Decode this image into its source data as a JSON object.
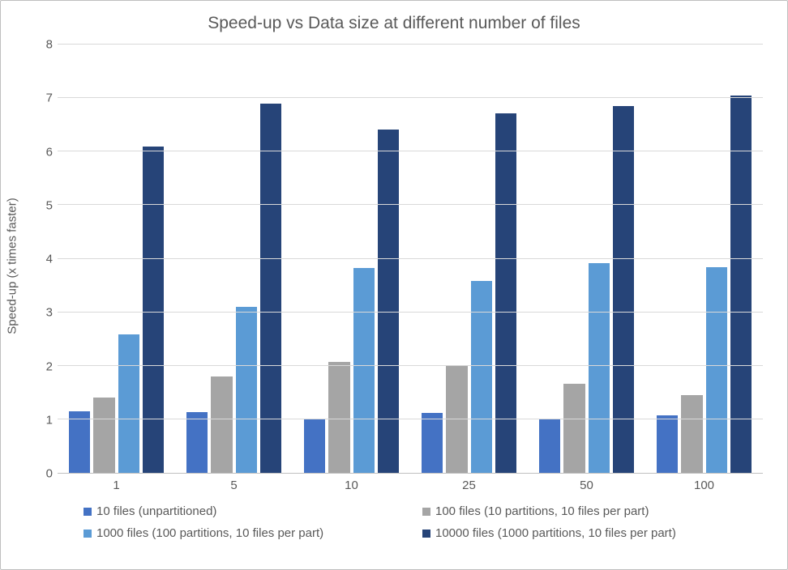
{
  "chart_data": {
    "type": "bar",
    "title": "Speed-up vs Data size at different number of files",
    "xlabel": "",
    "ylabel": "Speed-up (x times faster)",
    "categories": [
      "1",
      "5",
      "10",
      "25",
      "50",
      "100"
    ],
    "ylim": [
      0,
      8
    ],
    "yticks": [
      0,
      1,
      2,
      3,
      4,
      5,
      6,
      7,
      8
    ],
    "series": [
      {
        "name": "10 files (unpartitioned)",
        "color": "#4472c4",
        "values": [
          1.15,
          1.13,
          1.02,
          1.12,
          1.02,
          1.07
        ]
      },
      {
        "name": "100 files (10 partitions, 10 files per part)",
        "color": "#a5a5a5",
        "values": [
          1.4,
          1.8,
          2.07,
          1.99,
          1.66,
          1.45
        ]
      },
      {
        "name": "1000 files (100 partitions, 10 files per part)",
        "color": "#5b9bd5",
        "values": [
          2.58,
          3.1,
          3.82,
          3.58,
          3.92,
          3.84
        ]
      },
      {
        "name": "10000 files (1000 partitions, 10 files per part)",
        "color": "#264478",
        "values": [
          6.09,
          6.89,
          6.41,
          6.71,
          6.85,
          7.05
        ]
      }
    ]
  }
}
